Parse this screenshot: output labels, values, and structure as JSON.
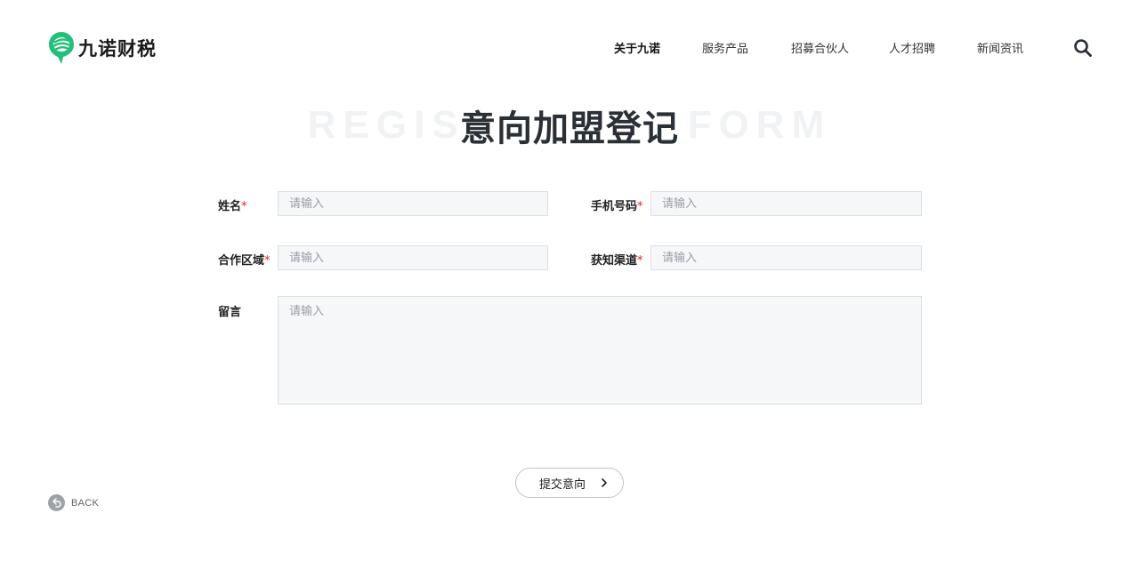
{
  "brand": {
    "name": "九诺财税",
    "accent": "#22c07a"
  },
  "nav": {
    "items": [
      {
        "label": "关于九诺",
        "active": true
      },
      {
        "label": "服务产品",
        "active": false
      },
      {
        "label": "招募合伙人",
        "active": false
      },
      {
        "label": "人才招聘",
        "active": false
      },
      {
        "label": "新闻资讯",
        "active": false
      }
    ],
    "search_icon": "search-icon"
  },
  "title": {
    "main": "意向加盟登记",
    "background_left": "REGIS",
    "background_right": "FORM"
  },
  "form": {
    "name": {
      "label": "姓名",
      "required_mark": "*",
      "placeholder": "请输入"
    },
    "phone": {
      "label": "手机号码",
      "required_mark": "*",
      "placeholder": "请输入"
    },
    "region": {
      "label": "合作区域",
      "required_mark": "*",
      "placeholder": "请输入"
    },
    "channel": {
      "label": "获知渠道",
      "required_mark": "*",
      "placeholder": "请输入"
    },
    "message": {
      "label": "留言",
      "placeholder": "请输入"
    },
    "submit_label": "提交意向"
  },
  "back": {
    "label": "BACK"
  },
  "colors": {
    "required": "#e1251b",
    "title": "#2b2f36",
    "input_bg": "#f6f7f9"
  }
}
